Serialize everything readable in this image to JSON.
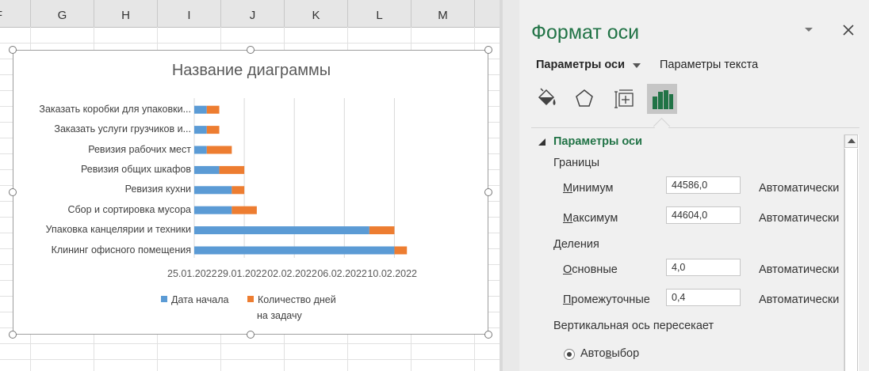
{
  "sheet": {
    "columns": [
      "F",
      "G",
      "H",
      "I",
      "J",
      "K",
      "L",
      "M"
    ]
  },
  "chart_data": {
    "type": "bar",
    "orientation": "horizontal",
    "stacked": true,
    "title": "Название диаграммы",
    "categories": [
      "Заказать коробки для упаковки...",
      "Заказать услуги грузчиков и...",
      "Ревизия рабочих мест",
      "Ревизия общих шкафов",
      "Ревизия кухни",
      "Сбор и сортировка мусора",
      "Упаковка канцелярии и техники",
      "Клининг офисного помещения"
    ],
    "start_dates": [
      "2022-01-26",
      "2022-01-26",
      "2022-01-26",
      "2022-01-27",
      "2022-01-28",
      "2022-01-28",
      "2022-02-08",
      "2022-02-10"
    ],
    "series": [
      {
        "name": "Дата начала",
        "values": [
          44587,
          44587,
          44587,
          44588,
          44589,
          44589,
          44600,
          44602
        ],
        "color": "#5b9bd5"
      },
      {
        "name": "Количество дней на задачу",
        "values": [
          1,
          1,
          2,
          2,
          1,
          2,
          2,
          1
        ],
        "color": "#ed7d31"
      }
    ],
    "xlim": [
      44586,
      44604
    ],
    "major_unit": 4,
    "tick_labels": [
      "25.01.2022",
      "29.01.2022",
      "02.02.2022",
      "06.02.2022",
      "10.02.2022"
    ],
    "legend": {
      "position": "bottom",
      "labels": [
        "Дата начала",
        "Количество дней",
        "на задачу"
      ]
    },
    "grid": true
  },
  "pane": {
    "title": "Формат оси",
    "tab_axis_options": "Параметры оси",
    "tab_text_options": "Параметры текста",
    "section_title": "Параметры оси",
    "bounds_heading": "Границы",
    "min_label_key": "М",
    "min_label_rest": "инимум",
    "min_value": "44586,0",
    "max_label_key": "М",
    "max_label_rest": "аксимум",
    "max_value": "44604,0",
    "units_heading": "Деления",
    "major_label_key": "О",
    "major_label_rest": "сновные",
    "major_value": "4,0",
    "minor_label_key": "П",
    "minor_label_rest": "ромежуточные",
    "minor_value": "0,4",
    "auto_label": "Автоматически",
    "vertical_cross_heading": "Вертикальная ось пересекает",
    "auto_select_pre": "Авто",
    "auto_select_key": "в",
    "auto_select_post": "ыбор"
  },
  "colors": {
    "accent_green": "#217346",
    "start_series": "#5b9bd5",
    "duration_series": "#ed7d31"
  }
}
